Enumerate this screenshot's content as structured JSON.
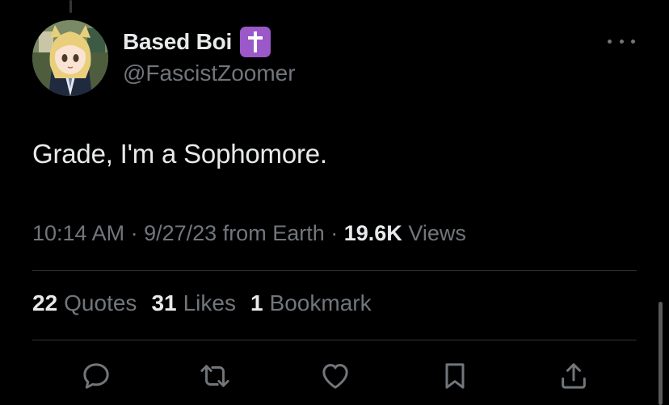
{
  "author": {
    "display_name": "Based Boi",
    "badge_emoji": "latin-cross-emoji",
    "handle": "@FascistZoomer"
  },
  "tweet": {
    "text": "Grade, I'm a Sophomore.",
    "time": "10:14 AM",
    "date": "9/27/23",
    "source": "from Earth",
    "views_count": "19.6K",
    "views_label": "Views"
  },
  "stats": {
    "quotes_count": "22",
    "quotes_label": "Quotes",
    "likes_count": "31",
    "likes_label": "Likes",
    "bookmarks_count": "1",
    "bookmarks_label": "Bookmark"
  },
  "icons": [
    "more-icon",
    "reply-icon",
    "retweet-icon",
    "like-icon",
    "bookmark-icon",
    "share-icon"
  ],
  "colors": {
    "background": "#000000",
    "primary_text": "#e7e9ea",
    "secondary_text": "#71767b",
    "divider": "#2f3336",
    "badge": "#9b58c9"
  }
}
